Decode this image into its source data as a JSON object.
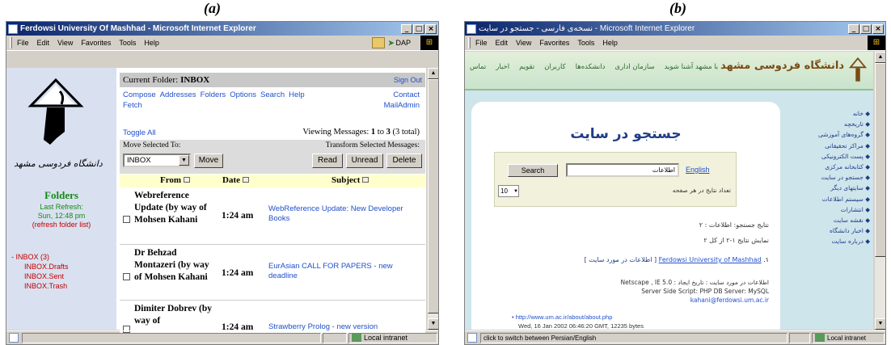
{
  "captions": {
    "a": "(a)",
    "b": "(b)"
  },
  "winA": {
    "title": "Ferdowsi University Of Mashhad - Microsoft Internet Explorer",
    "menu": [
      "File",
      "Edit",
      "View",
      "Favorites",
      "Tools",
      "Help"
    ],
    "toolbar_label": "DAP",
    "left": {
      "folders_title": "Folders",
      "last_refresh": "Last Refresh:",
      "refresh_time": "Sun, 12:48 pm",
      "refresh_link": "(refresh folder list)",
      "inbox": "INBOX (3)",
      "subfolders": [
        "INBOX.Drafts",
        "INBOX.Sent",
        "INBOX.Trash"
      ],
      "logo_script": "دانشگاه فردوسی مشهد"
    },
    "header": {
      "current_folder_label": "Current Folder:",
      "current_folder": "INBOX",
      "sign_out": "Sign Out",
      "nav": [
        "Compose",
        "Addresses",
        "Folders",
        "Options",
        "Search",
        "Help"
      ],
      "fetch": "Fetch",
      "contact": "Contact",
      "mailadmin": "MailAdmin"
    },
    "toggle_all": "Toggle All",
    "viewing": "Viewing Messages:",
    "viewing_from": "1",
    "viewing_to": "to",
    "viewing_count": "3",
    "viewing_total": "(3 total)",
    "move_selected": "Move Selected To:",
    "transform_selected": "Transform Selected Messages:",
    "move_select_value": "INBOX",
    "move_button": "Move",
    "read_button": "Read",
    "unread_button": "Unread",
    "delete_button": "Delete",
    "columns": {
      "from": "From",
      "date": "Date",
      "subject": "Subject"
    },
    "messages": [
      {
        "from": "Webreference Update (by way of Mohsen Kahani",
        "date": "1:24 am",
        "subject": "WebReference Update: New Developer Books"
      },
      {
        "from": "Dr Behzad Montazeri (by way of Mohsen Kahani",
        "date": "1:24 am",
        "subject": "EurAsian CALL FOR PAPERS - new deadline"
      },
      {
        "from": "Dimiter Dobrev (by way of",
        "date": "1:24 am",
        "subject": "Strawberry Prolog - new version"
      }
    ],
    "status": "Local intranet"
  },
  "winB": {
    "title": "نسخه‌ی فارسی - جستجو در سایت - Microsoft Internet Explorer",
    "menu": [
      "File",
      "Edit",
      "View",
      "Favorites",
      "Tools",
      "Help"
    ],
    "nav_links": [
      "تماس",
      "اخبار",
      "تقویم",
      "کاربران",
      "دانشکده‌ها",
      "سازمان اداری",
      "با مشهد آشنا شوید"
    ],
    "university_name": "دانشگاه فردوسی مشهد",
    "page_heading": "جستجو در سایت",
    "search_button": "Search",
    "english_link": "English",
    "search_hint": "اطلاعات",
    "options_line": "تعداد نتایج در هر صفحه",
    "results_per_page": "10",
    "sidebar_links": [
      "خانه",
      "تاریخچه",
      "گروه‌های آموزشی",
      "مراکز تحقیقاتی",
      "پست الکترونیکی",
      "کتابخانه مرکزی",
      "جستجو در سایت",
      "سایتهای دیگر",
      "سیستم اطلاعات",
      "انتشارات",
      "نقشه سایت",
      "اخبار دانشگاه",
      "درباره سایت"
    ],
    "results_title": "نتایج جستجو: اطلاعات : ۲",
    "results_range": "نمایش نتایج ۱-۲ از کل ۲",
    "result_1_title": "Ferdowsi University of Mashhad",
    "result_1_prefix": "۱.",
    "result_1_suffix": "[ اطلاعات در مورد سایت ]",
    "result_1_body": "اطلاعات در مورد سایت : تاریخ ایجاد : Netscape , IE 5.0",
    "result_1_body2": "Server Side Script: PHP DB Server: MySQL",
    "result_1_body3": "kahani@ferdowsi.um.ac.ir",
    "result_url": "http://www.um.ac.ir/about/about.php",
    "result_date": "Wed, 16 Jan 2002 06:46:20 GMT, 12235 bytes",
    "status_left": "click to switch between Persian/English",
    "status_right": "Local intranet"
  }
}
